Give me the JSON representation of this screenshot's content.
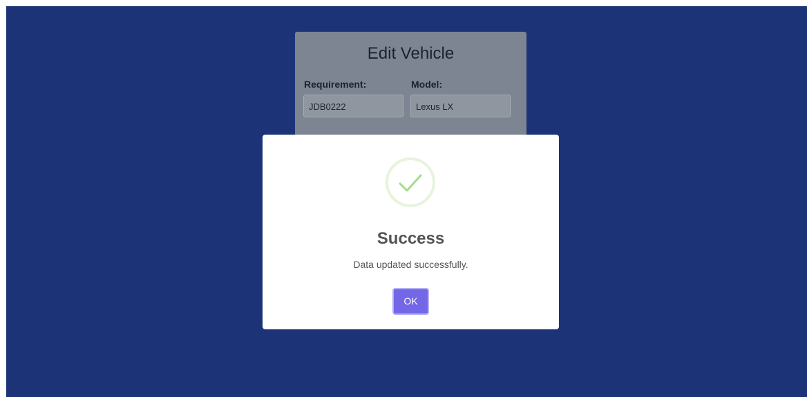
{
  "form": {
    "title": "Edit Vehicle",
    "fields": [
      {
        "label": "Requirement:",
        "value": "JDB0222"
      },
      {
        "label": "Model:",
        "value": "Lexus LX"
      }
    ]
  },
  "modal": {
    "icon": "checkmark-icon",
    "title": "Success",
    "message": "Data updated successfully.",
    "ok_label": "OK"
  },
  "colors": {
    "page_background": "#1c3477",
    "form_background": "#7c8591",
    "ok_button": "#7367e8",
    "success_check": "#a5dc86"
  }
}
